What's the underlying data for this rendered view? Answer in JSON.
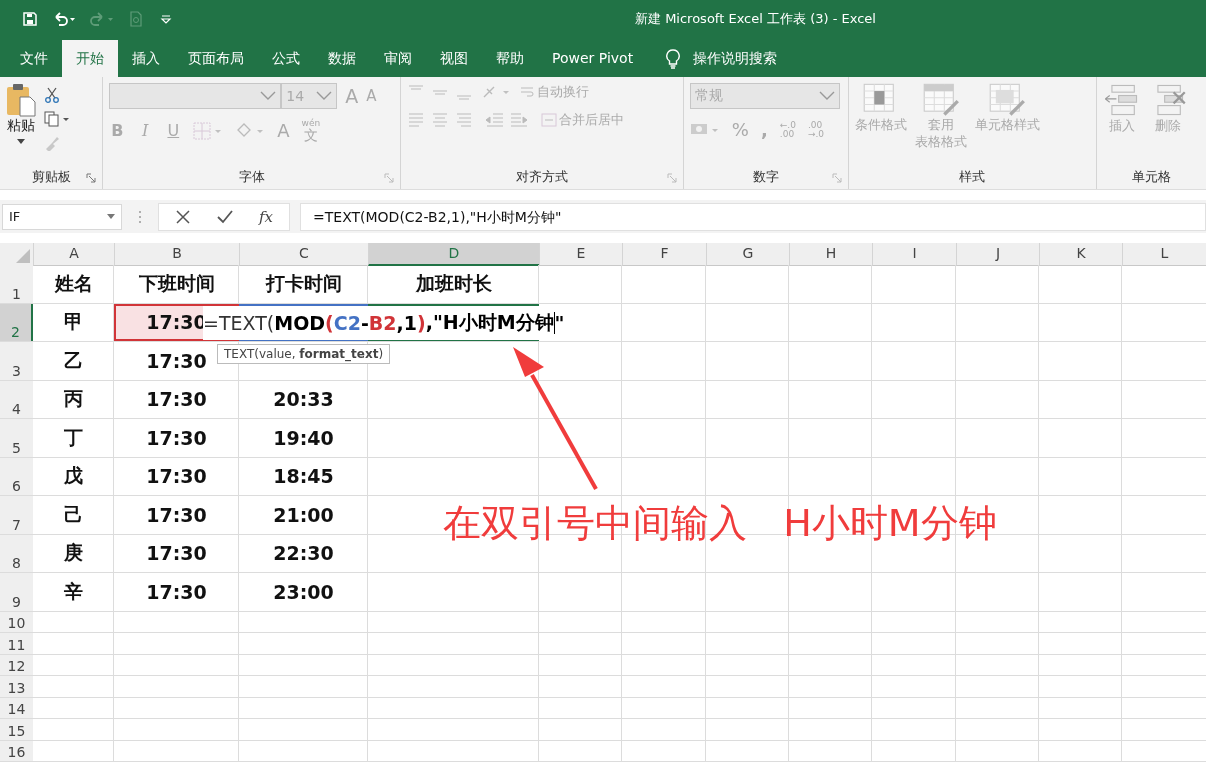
{
  "window": {
    "title": "新建 Microsoft Excel 工作表 (3)  -  Excel"
  },
  "tabs": [
    {
      "label": "文件",
      "selected": false
    },
    {
      "label": "开始",
      "selected": true
    },
    {
      "label": "插入",
      "selected": false
    },
    {
      "label": "页面布局",
      "selected": false
    },
    {
      "label": "公式",
      "selected": false
    },
    {
      "label": "数据",
      "selected": false
    },
    {
      "label": "审阅",
      "selected": false
    },
    {
      "label": "视图",
      "selected": false
    },
    {
      "label": "帮助",
      "selected": false
    },
    {
      "label": "Power Pivot",
      "selected": false
    }
  ],
  "tell_me": {
    "placeholder": "操作说明搜索"
  },
  "ribbon": {
    "clipboard": {
      "label": "剪贴板",
      "paste": {
        "label": "粘贴",
        "disabled": false
      },
      "format_painter_disabled": true
    },
    "font": {
      "label": "字体",
      "font_size": "14",
      "grow": "A",
      "shrink": "A",
      "font_color": "A",
      "phonetic_top": "wén",
      "phonetic_bottom": "文",
      "styles": [
        {
          "label": "B",
          "kind": "bold"
        },
        {
          "label": "I",
          "kind": "italic"
        },
        {
          "label": "U",
          "kind": "underline"
        }
      ],
      "disabled": true
    },
    "alignment": {
      "label": "对齐方式",
      "wrap": "自动换行",
      "merge": "合并后居中",
      "disabled": true
    },
    "number": {
      "label": "数字",
      "format": "常规",
      "percent": "%",
      "comma": ",",
      "inc_top": "←.0",
      "inc_bottom": ".00",
      "dec_top": ".00",
      "dec_bottom": "→.0",
      "disabled": true
    },
    "styles": {
      "label": "样式",
      "commands": [
        {
          "lines": [
            "条件格式"
          ],
          "kind": "conditional"
        },
        {
          "lines": [
            "套用",
            "表格格式"
          ],
          "kind": "table"
        },
        {
          "lines": [
            "单元格样式"
          ],
          "kind": "cellstyle"
        }
      ],
      "disabled": true
    },
    "cells": {
      "label": "单元格",
      "commands": [
        {
          "label": "插入",
          "kind": "insert"
        },
        {
          "label": "删除",
          "kind": "delete"
        }
      ],
      "disabled": true
    }
  },
  "formula_bar": {
    "name_box": "IF",
    "fx": "fx",
    "value": "=TEXT(MOD(C2-B2,1),\"H小时M分钟\""
  },
  "sheet": {
    "columns": [
      {
        "label": "A",
        "selected": false
      },
      {
        "label": "B",
        "selected": false
      },
      {
        "label": "C",
        "selected": false
      },
      {
        "label": "D",
        "selected": true
      },
      {
        "label": "E",
        "selected": false
      },
      {
        "label": "F",
        "selected": false
      },
      {
        "label": "G",
        "selected": false
      },
      {
        "label": "H",
        "selected": false
      },
      {
        "label": "I",
        "selected": false
      },
      {
        "label": "J",
        "selected": false
      },
      {
        "label": "K",
        "selected": false
      },
      {
        "label": "L",
        "selected": false
      }
    ],
    "rows": [
      {
        "number": "1",
        "selected": false,
        "cells": [
          "姓名",
          "下班时间",
          "打卡时间",
          "加班时长"
        ]
      },
      {
        "number": "2",
        "selected": true,
        "cells": [
          "甲",
          {
            "text": "17:30",
            "color": "#d13438"
          },
          {
            "color": "#4472c4"
          },
          {
            "color": "#217346"
          }
        ]
      },
      {
        "number": "3",
        "selected": false,
        "cells": [
          "乙",
          "17:30"
        ]
      },
      {
        "number": "4",
        "selected": false,
        "cells": [
          "丙",
          "17:30",
          "20:33"
        ]
      },
      {
        "number": "5",
        "selected": false,
        "cells": [
          "丁",
          "17:30",
          "19:40"
        ]
      },
      {
        "number": "6",
        "selected": false,
        "cells": [
          "戊",
          "17:30",
          "18:45"
        ]
      },
      {
        "number": "7",
        "selected": false,
        "cells": [
          "己",
          "17:30",
          "21:00"
        ]
      },
      {
        "number": "8",
        "selected": false,
        "cells": [
          "庚",
          "17:30",
          "22:30"
        ]
      },
      {
        "number": "9",
        "selected": false,
        "cells": [
          "辛",
          "17:30",
          "23:00"
        ]
      },
      {
        "number": "10",
        "selected": false
      },
      {
        "number": "11",
        "selected": false
      },
      {
        "number": "12",
        "selected": false
      },
      {
        "number": "13",
        "selected": false
      },
      {
        "number": "14",
        "selected": false
      },
      {
        "number": "15",
        "selected": false
      },
      {
        "number": "16",
        "selected": false
      }
    ],
    "edit": {
      "segments": [
        {
          "text": "=TEXT(",
          "color": "#333333",
          "bold": false
        },
        {
          "text": "MOD",
          "color": "#000000",
          "bold": true
        },
        {
          "text": "(",
          "color": "#d13438",
          "bold": true
        },
        {
          "text": "C2",
          "color": "#4472c4",
          "bold": true
        },
        {
          "text": "-",
          "color": "#000000",
          "bold": true
        },
        {
          "text": "B2",
          "color": "#d13438",
          "bold": true
        },
        {
          "text": ",1",
          "color": "#000000",
          "bold": true
        },
        {
          "text": ")",
          "color": "#d13438",
          "bold": true
        },
        {
          "text": ",\"H小时M分钟",
          "color": "#000000",
          "bold": true
        },
        {
          "text": "\"",
          "color": "#000000",
          "bold": true,
          "cursor_before": true
        }
      ],
      "tooltip": "TEXT(value, **format_text**)"
    }
  },
  "annotation": {
    "text": "在双引号中间输入   H小时M分钟"
  }
}
